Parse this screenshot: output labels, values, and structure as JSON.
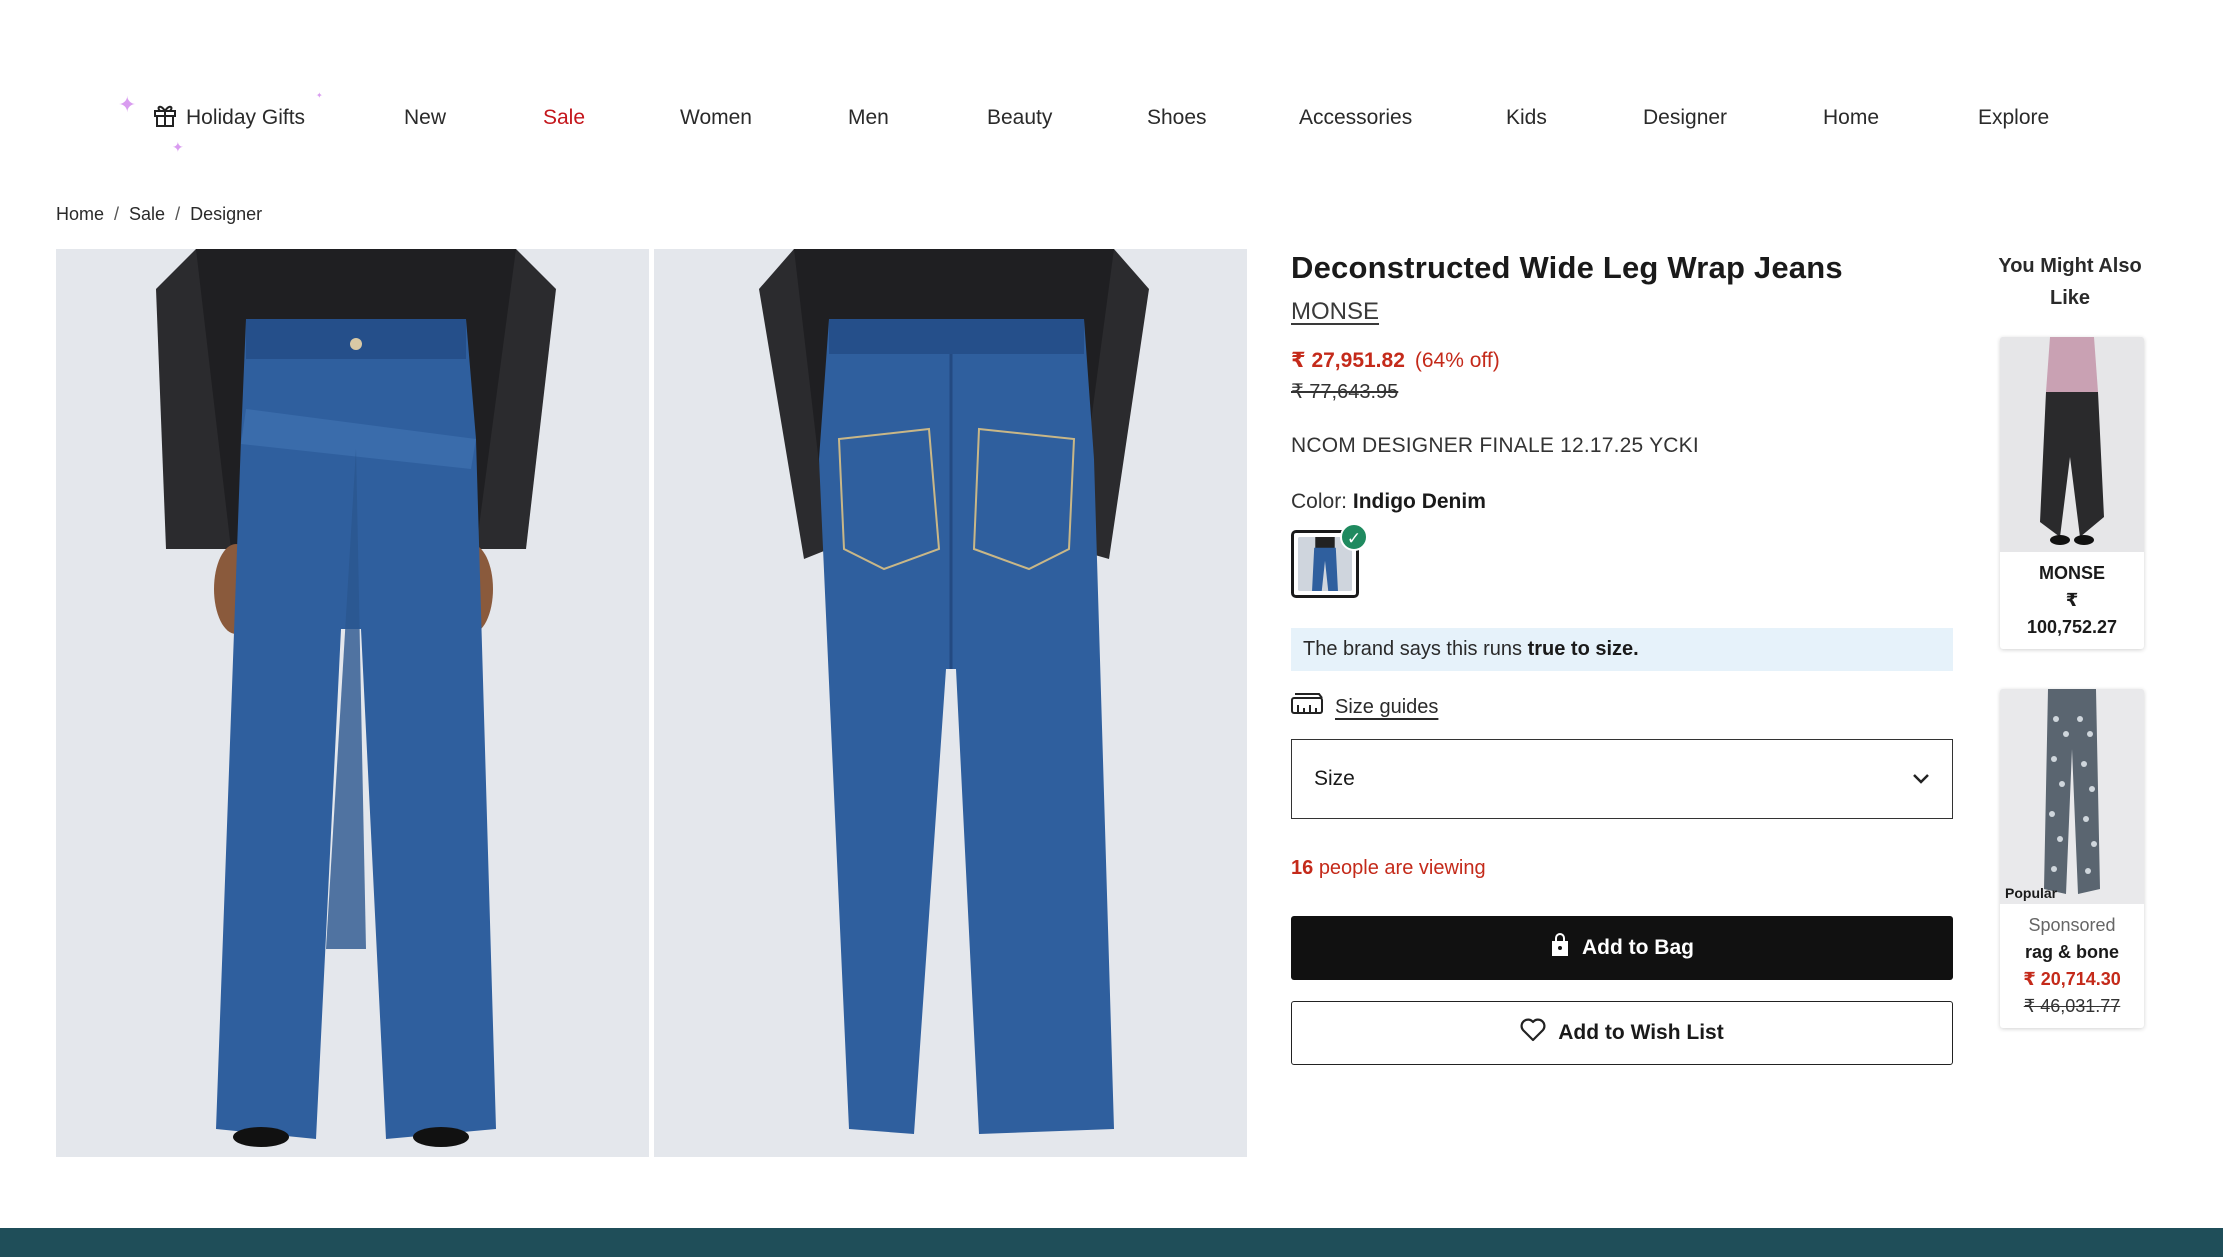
{
  "nav": {
    "holiday": "Holiday Gifts",
    "items": [
      "New",
      "Sale",
      "Women",
      "Men",
      "Beauty",
      "Shoes",
      "Accessories",
      "Kids",
      "Designer",
      "Home",
      "Explore"
    ]
  },
  "breadcrumb": [
    "Home",
    "Sale",
    "Designer"
  ],
  "breadcrumb_sep": "/",
  "product": {
    "title": "Deconstructed Wide Leg Wrap Jeans",
    "brand": "MONSE",
    "price_now": "₹ 27,951.82",
    "price_off": "(64% off)",
    "price_was": "₹ 77,643.95",
    "promo_code": "NCOM DESIGNER FINALE 12.17.25 YCKI",
    "color_label": "Color:",
    "color_value": "Indigo Denim",
    "fit_prefix": "The brand says this runs",
    "fit_bold": "true to size.",
    "size_guides": "Size guides",
    "size_placeholder": "Size",
    "viewing_count": "16",
    "viewing_text": "people are viewing",
    "add_to_bag": "Add to Bag",
    "add_to_wishlist": "Add to Wish List"
  },
  "recommendations": {
    "title": "You Might Also Like",
    "items": [
      {
        "brand": "MONSE",
        "currency": "₹",
        "price": "100,752.27"
      },
      {
        "badge": "Popular",
        "sponsored": "Sponsored",
        "brand": "rag & bone",
        "price_now": "₹ 20,714.30",
        "price_was": "₹ 46,031.77"
      }
    ]
  },
  "colors": {
    "sale": "#c4161c",
    "price": "#c42a1a",
    "footer": "#1f4e59",
    "check": "#1f8a5f",
    "fit_bg": "#e6f2fa"
  }
}
